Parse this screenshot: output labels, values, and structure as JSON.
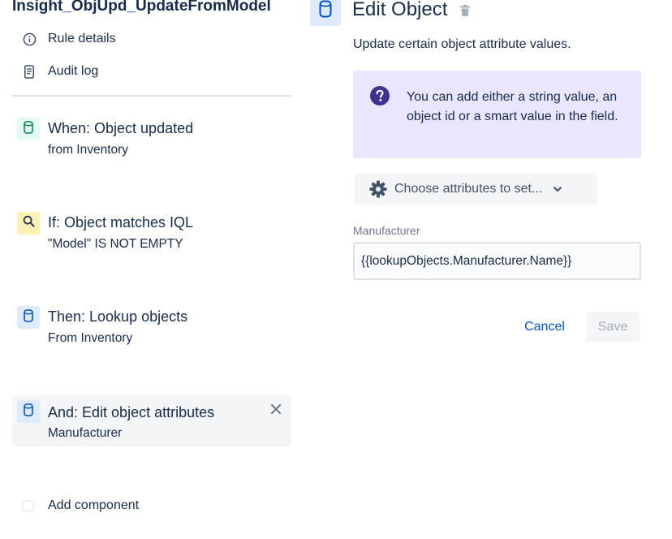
{
  "rule": {
    "title": "Insight_ObjUpd_UpdateFromModel"
  },
  "nav": [
    {
      "label": "Rule details",
      "icon": "info-icon"
    },
    {
      "label": "Audit log",
      "icon": "document-icon"
    }
  ],
  "components": [
    {
      "title": "When: Object updated",
      "subtitle": "from Inventory",
      "icon": "cylinder-icon",
      "badge_color": "#e3fcef",
      "icon_color": "#00875a"
    },
    {
      "title": "If: Object matches IQL",
      "subtitle": "\"Model\" IS NOT EMPTY",
      "icon": "search-icon",
      "badge_color": "#fff0b3",
      "icon_color": "#172b4d"
    },
    {
      "title": "Then: Lookup objects",
      "subtitle": "From Inventory",
      "icon": "cylinder-icon",
      "badge_color": "#deebff",
      "icon_color": "#0052cc"
    },
    {
      "title": "And: Edit object attributes",
      "subtitle": "Manufacturer",
      "icon": "cylinder-icon",
      "badge_color": "#deebff",
      "icon_color": "#0052cc",
      "selected": true
    }
  ],
  "add_component": {
    "label": "Add component"
  },
  "editor": {
    "title": "Edit Object",
    "description": "Update certain object attribute values.",
    "info": "You can add either a string value, an object id or a smart value in the field.",
    "choose_attributes_label": "Choose attributes to set...",
    "field": {
      "label": "Manufacturer",
      "value": "{{lookupObjects.Manufacturer.Name}}"
    },
    "cancel_label": "Cancel",
    "save_label": "Save"
  },
  "colors": {
    "accent": "#0052cc",
    "info_bg": "#eae6ff",
    "info_icon": "#403294"
  }
}
